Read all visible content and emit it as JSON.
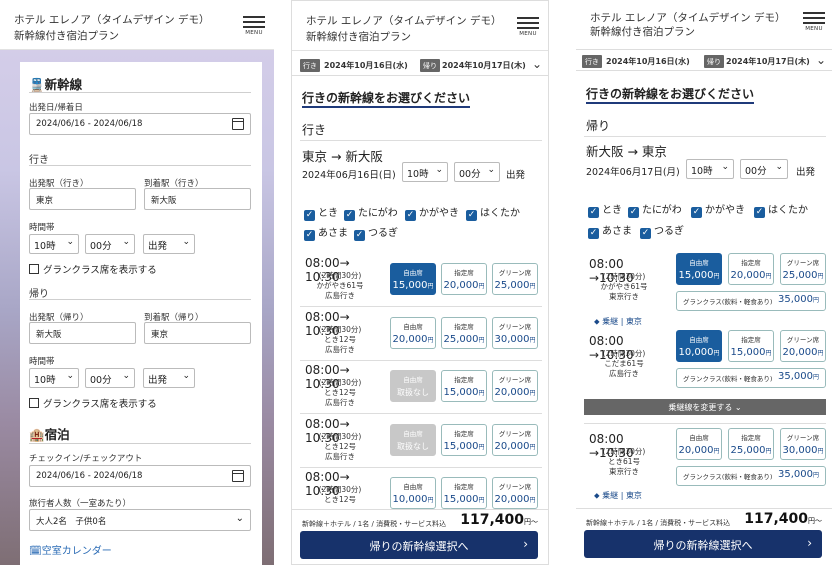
{
  "header": {
    "line1": "ホテル エレノア（タイムデザイン デモ）",
    "line2": "新幹線付き宿泊プラン",
    "menu": "MENU"
  },
  "form": {
    "shinkansen_title": "新幹線",
    "dates_label": "出発日/帰着日",
    "dates_value": "2024/06/16 - 2024/06/18",
    "outbound_title": "行き",
    "dep_station_label": "出発駅（行き）",
    "arr_station_label": "到着駅（行き）",
    "out_dep": "東京",
    "out_arr": "新大阪",
    "time_label": "時間帯",
    "hour": "10時",
    "minute": "00分",
    "mode": "出発",
    "grand_class": "グランクラス席を表示する",
    "return_title": "帰り",
    "ret_dep_label": "出発駅（帰り）",
    "ret_arr_label": "到着駅（帰り）",
    "ret_dep": "新大阪",
    "ret_arr": "東京",
    "hotel_title": "宿泊",
    "checkin_label": "チェックイン/チェックアウト",
    "checkin_value": "2024/06/16 - 2024/06/18",
    "guests_label": "旅行者人数（一室あたり）",
    "guests_value": "大人2名　子供0名",
    "calendar_link": "空室カレンダー"
  },
  "datebar": {
    "go_tag": "行き",
    "go_date": "2024年10月16日(水)",
    "ret_tag": "帰り",
    "ret_date": "2024年10月17日(木)"
  },
  "fare_labels": {
    "free": "自由席",
    "reserved": "指定席",
    "green": "グリーン席",
    "unavailable": "取扱なし",
    "yen": "円"
  },
  "outbound": {
    "heading": "行きの新幹線をお選びください",
    "direction": "行き",
    "route": "東京 → 新大阪",
    "date": "2024年06月16日(日)",
    "hour": "10時",
    "minute": "00分",
    "mode": "出発",
    "trains_filter": [
      "とき",
      "たにがわ",
      "かがやき",
      "はくたか",
      "あさま",
      "つるぎ"
    ],
    "results": [
      {
        "time": "08:00→ 10:30",
        "duration": "(2時間30分)",
        "name": "かがやき61号",
        "dest": "広島行き",
        "free": "15,000",
        "reserved": "20,000",
        "green": "25,000",
        "state": "selected"
      },
      {
        "time": "08:00→ 10:30",
        "duration": "(2時間30分)",
        "name": "とき12号",
        "dest": "広島行き",
        "free": "20,000",
        "reserved": "25,000",
        "green": "30,000",
        "state": "normal"
      },
      {
        "time": "08:00→ 10:30",
        "duration": "(2時間30分)",
        "name": "とき12号",
        "dest": "広島行き",
        "free": "",
        "reserved": "15,000",
        "green": "20,000",
        "state": "na"
      },
      {
        "time": "08:00→ 10:30",
        "duration": "(2時間30分)",
        "name": "とき12号",
        "dest": "広島行き",
        "free": "",
        "reserved": "15,000",
        "green": "20,000",
        "state": "na"
      },
      {
        "time": "08:00→ 10:30",
        "duration": "(2時間30分)",
        "name": "とき12号",
        "dest": "",
        "free": "10,000",
        "reserved": "15,000",
        "green": "20,000",
        "state": "normal"
      }
    ],
    "footer_summary": "新幹線＋ホテル / 1名 / 消費税・サービス料込",
    "footer_price": "117,400",
    "footer_unit": "円〜",
    "cta": "帰りの新幹線選択へ"
  },
  "return": {
    "heading": "行きの新幹線をお選びください",
    "direction": "帰り",
    "route": "新大阪 → 東京",
    "date": "2024年06月17日(月)",
    "hour": "10時",
    "minute": "00分",
    "mode": "出発",
    "trains_filter": [
      "とき",
      "たにがわ",
      "かがやき",
      "はくたか",
      "あさま",
      "つるぎ"
    ],
    "grand_label": "グランクラス(飲料・軽食あり)",
    "grand_price": "35,000",
    "transfer_label": "乗継",
    "transfer_station": "東京",
    "change_label": "乗継線を変更する",
    "results": [
      {
        "time": "08:00 →10:30",
        "duration": "(2時間30分)",
        "name": "かがやき61号",
        "dest": "東京行き",
        "free": "15,000",
        "reserved": "20,000",
        "green": "25,000",
        "state": "selected"
      },
      {
        "time": "08:00 →10:30",
        "duration": "(2時間30分)",
        "name": "こだま61号",
        "dest": "広島行き",
        "free": "10,000",
        "reserved": "15,000",
        "green": "20,000",
        "state": "selected"
      },
      {
        "time": "08:00 →10:30",
        "duration": "(2時間30分)",
        "name": "とき61号",
        "dest": "東京行き",
        "free": "20,000",
        "reserved": "25,000",
        "green": "30,000",
        "state": "normal"
      }
    ],
    "footer_summary": "新幹線＋ホテル / 1名 / 消費税・サービス料込",
    "footer_price": "117,400",
    "footer_unit": "円〜",
    "cta": "帰りの新幹線選択へ"
  },
  "colors": {
    "primary": "#1a5d9e",
    "cta": "#17326b",
    "link": "#2a6bb5"
  }
}
